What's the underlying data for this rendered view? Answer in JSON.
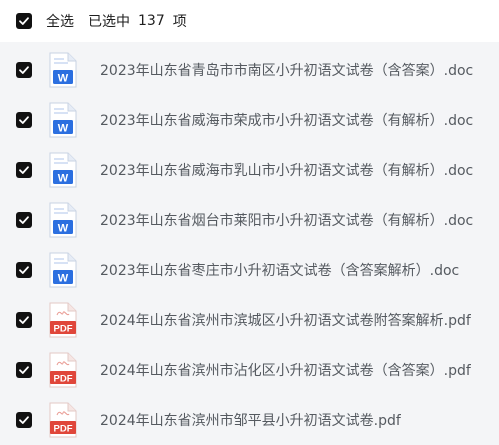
{
  "header": {
    "select_all_label": "全选",
    "selected_label": "已选中",
    "selected_count": "137",
    "selected_unit": "项",
    "checked": true
  },
  "files": [
    {
      "name": "2023年山东省青岛市市南区小升初语文试卷（含答案）.doc",
      "type": "doc",
      "checked": true,
      "icon": "word-doc-icon"
    },
    {
      "name": "2023年山东省威海市荣成市小升初语文试卷（有解析）.doc",
      "type": "doc",
      "checked": true,
      "icon": "word-doc-icon"
    },
    {
      "name": "2023年山东省威海市乳山市小升初语文试卷（有解析）.doc",
      "type": "doc",
      "checked": true,
      "icon": "word-doc-icon"
    },
    {
      "name": "2023年山东省烟台市莱阳市小升初语文试卷（有解析）.doc",
      "type": "doc",
      "checked": true,
      "icon": "word-doc-icon"
    },
    {
      "name": "2023年山东省枣庄市小升初语文试卷（含答案解析）.doc",
      "type": "doc",
      "checked": true,
      "icon": "word-doc-icon"
    },
    {
      "name": "2024年山东省滨州市滨城区小升初语文试卷附答案解析.pdf",
      "type": "pdf",
      "checked": true,
      "icon": "pdf-icon"
    },
    {
      "name": "2024年山东省滨州市沾化区小升初语文试卷（含答案）.pdf",
      "type": "pdf",
      "checked": true,
      "icon": "pdf-icon"
    },
    {
      "name": "2024年山东省滨州市邹平县小升初语文试卷.pdf",
      "type": "pdf",
      "checked": true,
      "icon": "pdf-icon"
    }
  ],
  "icon_labels": {
    "doc": "W",
    "pdf": "PDF"
  },
  "colors": {
    "checkbox": "#111111",
    "list_background": "#f4f5f7",
    "word_blue": "#2b6fe0",
    "pdf_red": "#e0463a",
    "file_text": "#555a60"
  }
}
